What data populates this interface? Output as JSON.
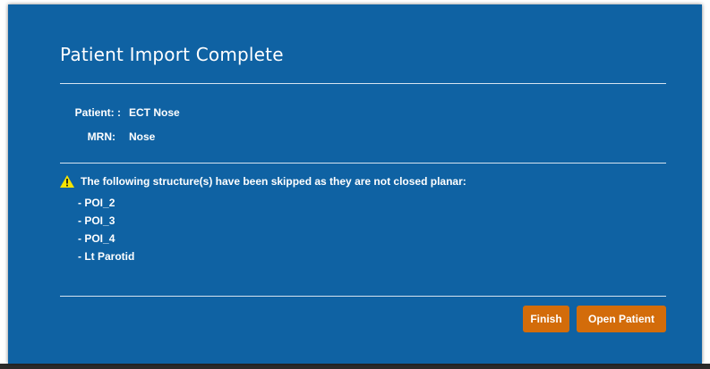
{
  "dialog": {
    "title": "Patient Import Complete",
    "patient_label": "Patient: :",
    "patient_value": "ECT Nose",
    "mrn_label": "MRN:",
    "mrn_value": "Nose",
    "warning_text": "The following structure(s) have been skipped as they are not closed planar:",
    "skipped_structures": [
      "POI_2",
      "POI_3",
      "POI_4",
      "Lt Parotid"
    ],
    "buttons": {
      "finish_label": "Finish",
      "open_patient_label": "Open Patient"
    }
  },
  "colors": {
    "dialog_bg": "#0f62a3",
    "button_bg": "#d36c0a",
    "warning_icon": "#f5e400",
    "text": "#ffffff"
  },
  "icons": {
    "warning": "warning-triangle-icon"
  }
}
